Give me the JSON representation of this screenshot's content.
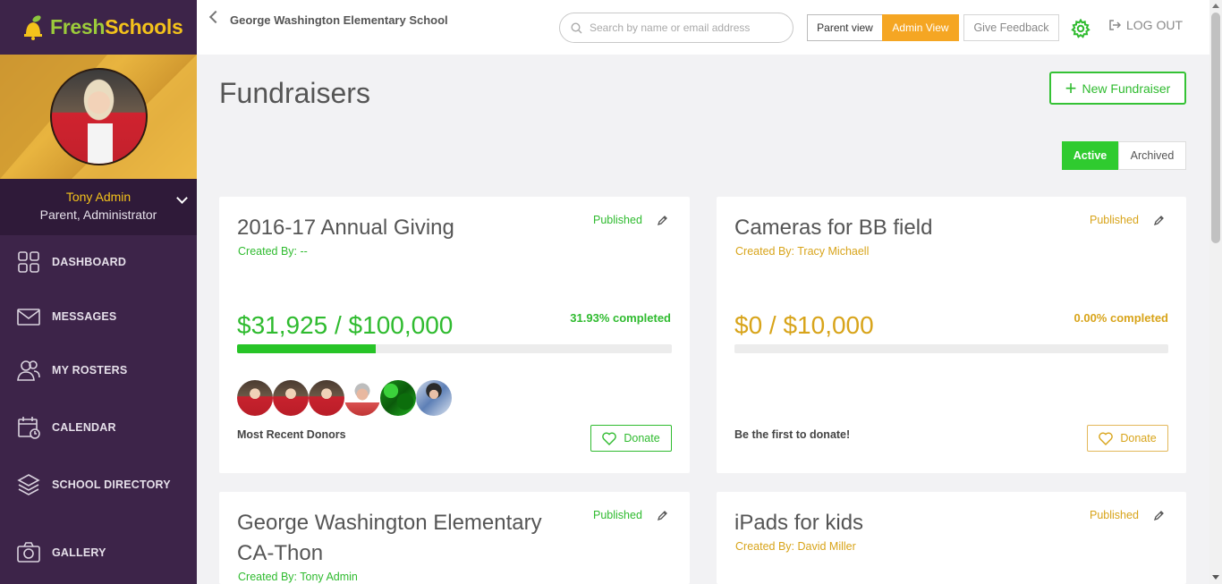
{
  "brand": {
    "name_part1": "Fresh",
    "name_part2": "Schools"
  },
  "user": {
    "name": "Tony Admin",
    "role": "Parent, Administrator"
  },
  "sidebar": {
    "items": [
      {
        "label": "DASHBOARD",
        "icon": "dashboard-icon"
      },
      {
        "label": "MESSAGES",
        "icon": "envelope-icon"
      },
      {
        "label": "MY ROSTERS",
        "icon": "users-icon"
      },
      {
        "label": "CALENDAR",
        "icon": "calendar-icon"
      },
      {
        "label": "SCHOOL DIRECTORY",
        "icon": "layers-icon"
      },
      {
        "label": "GALLERY",
        "icon": "camera-icon"
      }
    ]
  },
  "header": {
    "school": "George Washington Elementary School",
    "search_placeholder": "Search by name or email address",
    "parent_view": "Parent view",
    "admin_view": "Admin View",
    "feedback": "Give Feedback",
    "logout": "LOG OUT"
  },
  "page": {
    "title": "Fundraisers",
    "new_button": "New Fundraiser",
    "tabs": {
      "active": "Active",
      "archived": "Archived"
    }
  },
  "colors": {
    "accent_green": "#2fcb2f",
    "accent_amber": "#f5a623",
    "sidebar_purple": "#3d2449"
  },
  "fundraisers": [
    {
      "title": "2016-17 Annual Giving",
      "status": "Published",
      "created_by": "Created By: --",
      "amount": "$31,925 / $100,000",
      "completed": "31.93% completed",
      "progress": 0.3193,
      "footer_text": "Most Recent Donors",
      "donate": "Donate"
    },
    {
      "title": "Cameras for BB field",
      "status": "Published",
      "created_by": "Created By: Tracy Michaell",
      "amount": "$0 / $10,000",
      "completed": "0.00% completed",
      "progress": 0,
      "footer_text": "Be the first to donate!",
      "donate": "Donate"
    },
    {
      "title_line1": "George Washington Elementary",
      "title_line2": "CA-Thon",
      "status": "Published",
      "created_by": "Created By: Tony Admin"
    },
    {
      "title": "iPads for kids",
      "status": "Published",
      "created_by": "Created By: David Miller"
    }
  ]
}
